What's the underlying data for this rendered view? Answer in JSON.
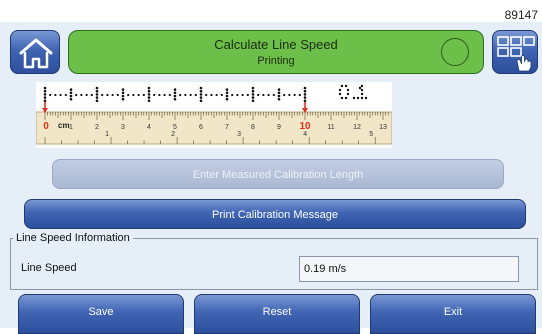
{
  "screen_id": "89147",
  "header": {
    "title": "Calculate Line Speed",
    "subtitle": "Printing",
    "home_icon": "home-icon",
    "menu_icon": "grid-menu-hand-icon"
  },
  "ruler": {
    "unit": "cm",
    "cm_labels": [
      "0",
      "1",
      "2",
      "3",
      "4",
      "5",
      "6",
      "7",
      "8",
      "9",
      "10",
      "11",
      "12",
      "13"
    ],
    "inch_labels": [
      "1",
      "2",
      "3",
      "4",
      "5"
    ],
    "marker_labels": [
      "0",
      "10"
    ]
  },
  "calibration": {
    "enter_label": "Enter Measured Calibration Length",
    "print_label": "Print Calibration Message"
  },
  "line_speed_info": {
    "legend": "Line Speed Information",
    "label": "Line Speed",
    "value": "0.19 m/s"
  },
  "footer": {
    "save_label": "Save",
    "reset_label": "Reset",
    "exit_label": "Exit"
  },
  "colors": {
    "title_green": "#6cc04a",
    "button_blue": "#4064b3",
    "marker_red": "#e0301e"
  }
}
